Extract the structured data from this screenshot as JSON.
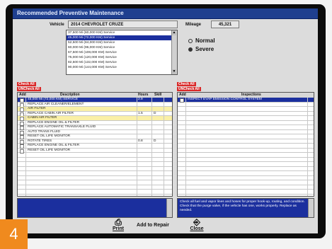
{
  "window": {
    "title": "Recommended Preventive Maintenance"
  },
  "vehicle": {
    "label": "Vehicle",
    "value": "2014 CHEVROLET CRUZE"
  },
  "mileage": {
    "label": "Mileage",
    "value": "45,321"
  },
  "service_list": {
    "items": [
      "37,500 Mi (60,000 KM) Service",
      "45,000 Mi (72,000 KM) Service",
      "52,500 Mi (84,000 KM) Service",
      "60,000 Mi (96,000 KM) Service",
      "67,500 Mi (108,000 KM) Service",
      "75,000 Mi (120,000 KM) Service",
      "82,500 Mi (132,000 KM) Service",
      "90,000 Mi (144,000 KM) Service"
    ],
    "selected_index": 1
  },
  "driving_mode": {
    "options": [
      "Normal",
      "Severe"
    ],
    "selected": "Severe"
  },
  "services_panel": {
    "check_all": "Check All",
    "uncheck_all": "UNCheck All",
    "headers": {
      "add": "Add",
      "description": "Description",
      "hours": "Hours",
      "skill": "Skill"
    },
    "rows": [
      {
        "description": "45,000 Mi (72,000 KM) SERVICE",
        "hours": "2.9",
        "skill": "",
        "style": "selected"
      },
      {
        "description": "REPLACE AIR CLEANER/ELEMENT",
        "hours": "",
        "skill": "",
        "style": ""
      },
      {
        "description": "AIR FILTER",
        "hours": "",
        "skill": "",
        "style": "highlight"
      },
      {
        "description": "REPLACE CABIN AIR FILTER",
        "hours": "1.5",
        "skill": "D",
        "style": ""
      },
      {
        "description": "CABIN AIR FILTER",
        "hours": "",
        "skill": "",
        "style": "highlight"
      },
      {
        "description": "REPLACE ENGINE OIL & FILTER",
        "hours": "",
        "skill": "",
        "style": ""
      },
      {
        "description": "REPLACE AUTOMATIC TRANSAXLE FLUID",
        "hours": "",
        "skill": "",
        "style": ""
      },
      {
        "description": "AUTO TRANS FLUID",
        "hours": "",
        "skill": "",
        "style": ""
      },
      {
        "description": "RESET OIL LIFE MONITOR",
        "hours": "",
        "skill": "",
        "style": ""
      },
      {
        "description": "ROTATE TIRES",
        "hours": "0.8",
        "skill": "D",
        "style": ""
      },
      {
        "description": "REPLACE ENGINE OIL & FILTER",
        "hours": "",
        "skill": "",
        "style": ""
      },
      {
        "description": "RESET OIL LIFE MONITOR",
        "hours": "",
        "skill": "",
        "style": ""
      }
    ],
    "empty_rows": 10
  },
  "inspections_panel": {
    "check_all": "Check All",
    "uncheck_all": "UNCheck All",
    "headers": {
      "add": "Add",
      "inspections": "Inspections"
    },
    "rows": [
      {
        "text": "INSPECT EVAP EMISSION CONTROL SYSTEM",
        "style": "selected"
      }
    ],
    "empty_rows": 21,
    "notes": "Check all fuel and vapor lines and hoses for proper hook-up, routing, and condition. Check that the purge valve, if the vehicle has one, works properly. Replace as needed."
  },
  "footer": {
    "print": "Print",
    "add_to_repair": "Add to Repair",
    "close": "Close"
  },
  "step_badge": "4",
  "colors": {
    "selection": "#1b2f9e",
    "highlight": "#faf0a6",
    "check_button": "#d92929",
    "badge": "#f08a1e"
  }
}
